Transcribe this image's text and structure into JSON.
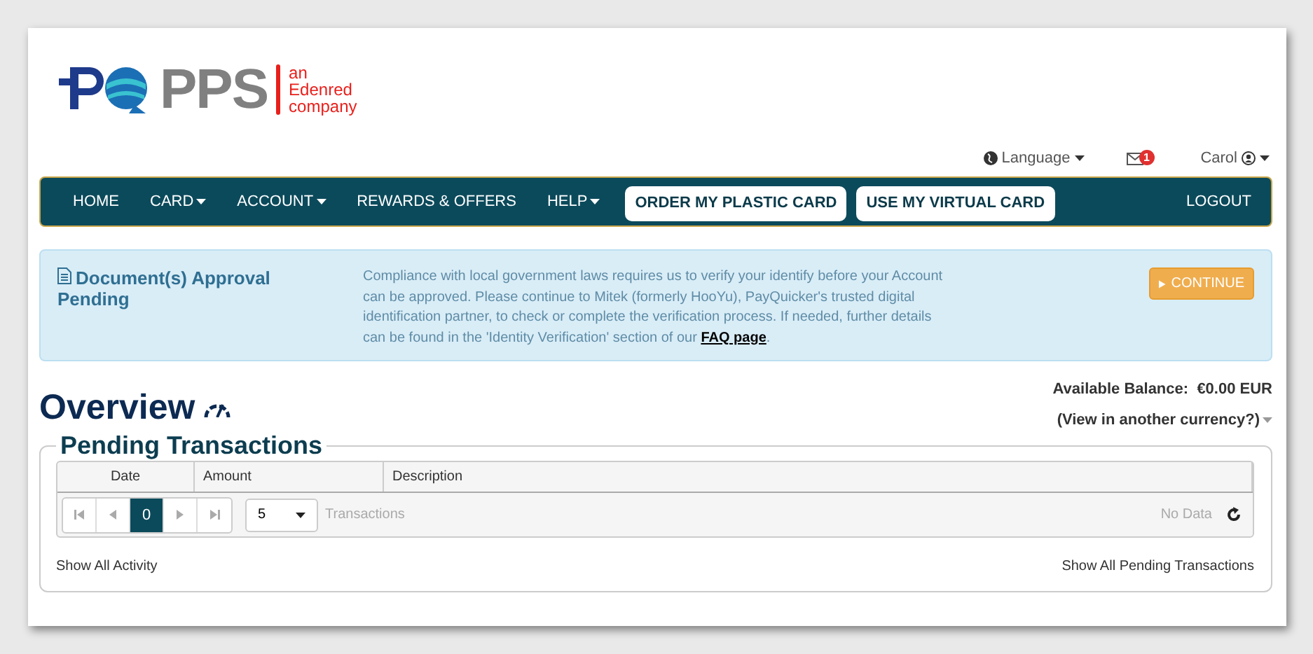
{
  "logo": {
    "name": "PPS",
    "tagline": [
      "an",
      "Edenred",
      "company"
    ]
  },
  "top_bar": {
    "language": "Language",
    "messages_badge": "1",
    "user": "Carol"
  },
  "nav": {
    "items": [
      {
        "label": "HOME",
        "kind": "link",
        "dropdown": false
      },
      {
        "label": "CARD",
        "kind": "link",
        "dropdown": true
      },
      {
        "label": "ACCOUNT",
        "kind": "link",
        "dropdown": true
      },
      {
        "label": "REWARDS & OFFERS",
        "kind": "link",
        "dropdown": false
      },
      {
        "label": "HELP",
        "kind": "link",
        "dropdown": true
      },
      {
        "label": "ORDER MY PLASTIC CARD",
        "kind": "button",
        "dropdown": false
      },
      {
        "label": "USE MY VIRTUAL CARD",
        "kind": "button",
        "dropdown": false
      }
    ],
    "logout": "LOGOUT"
  },
  "alert": {
    "title": "Document(s) Approval Pending",
    "message": "Compliance with local government laws requires us to verify your identify before your Account can be approved. Please continue to Mitek (formerly HooYu), PayQuicker's trusted digital identification partner, to check or complete the verification process. If needed, further details can be found in the 'Identity Verification' section of our ",
    "link": "FAQ page",
    "message_end": ".",
    "button": "CONTINUE"
  },
  "overview": {
    "title": "Overview",
    "balance_label": "Available Balance:",
    "balance": "€0.00 EUR",
    "currency_link": "(View in another currency?)"
  },
  "pending": {
    "title": "Pending Transactions",
    "columns": [
      "Date",
      "Amount",
      "Description"
    ],
    "pager": {
      "pages": [
        {
          "label": "0",
          "selected": true
        }
      ],
      "page_size": "5",
      "page_size_label": "Transactions",
      "status": "No Data"
    },
    "show_all": "Show All Activity",
    "show_pending": "Show All Pending Transactions"
  }
}
